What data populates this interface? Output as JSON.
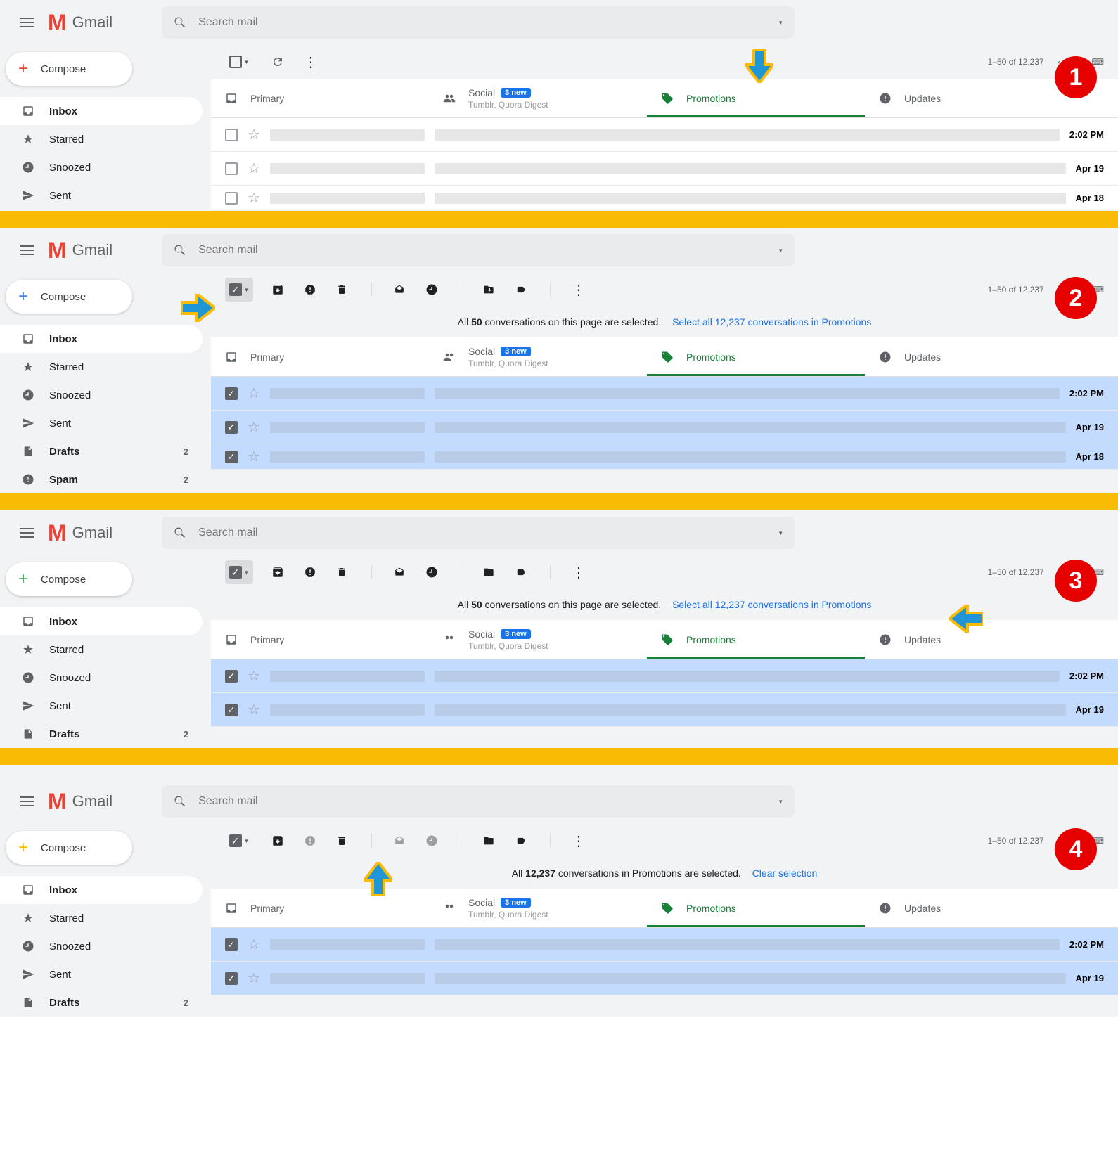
{
  "brand": "Gmail",
  "search_placeholder": "Search mail",
  "compose": "Compose",
  "pagination": "1–50 of 12,237",
  "nav": {
    "inbox": "Inbox",
    "starred": "Starred",
    "snoozed": "Snoozed",
    "sent": "Sent",
    "drafts": "Drafts",
    "drafts_count": "2",
    "spam": "Spam",
    "spam_count": "2"
  },
  "tabs": {
    "primary": "Primary",
    "social": "Social",
    "social_badge": "3 new",
    "social_sub": "Tumblr, Quora Digest",
    "promotions": "Promotions",
    "updates": "Updates"
  },
  "banner": {
    "pre": "All ",
    "page_count": "50",
    "mid": " conversations on this page are selected.",
    "link": "Select all 12,237 conversations in Promotions",
    "all_pre": "All ",
    "all_count": "12,237",
    "all_mid": " conversations in Promotions are selected.",
    "clear": "Clear selection"
  },
  "rows": {
    "t1": "2:02 PM",
    "t2": "Apr 19",
    "t3": "Apr 18"
  },
  "steps": {
    "s1": "1",
    "s2": "2",
    "s3": "3",
    "s4": "4"
  }
}
